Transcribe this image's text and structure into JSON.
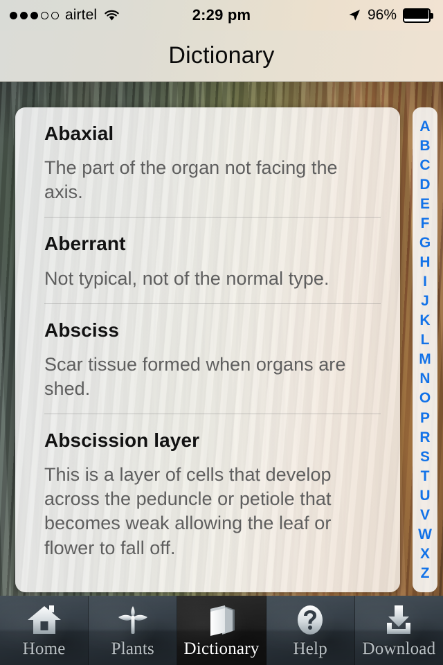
{
  "status_bar": {
    "signal_dots_filled": 3,
    "signal_dots_total": 5,
    "carrier": "airtel",
    "wifi_icon": "wifi-icon",
    "time": "2:29 pm",
    "location_icon": "location-arrow-icon",
    "battery_percent": "96%",
    "battery_level": 96
  },
  "navbar": {
    "title": "Dictionary"
  },
  "dictionary": {
    "entries": [
      {
        "term": "Abaxial",
        "definition": "The part of the organ not facing the axis."
      },
      {
        "term": "Aberrant",
        "definition": "Not typical, not of the normal type."
      },
      {
        "term": "Absciss",
        "definition": "Scar tissue formed when organs are shed."
      },
      {
        "term": "Abscission layer",
        "definition": "This is a layer of cells that develop across the peduncle or petiole that becomes weak allowing the leaf or flower to fall off."
      }
    ]
  },
  "index_strip": {
    "letters": [
      "A",
      "B",
      "C",
      "D",
      "E",
      "F",
      "G",
      "H",
      "I",
      "J",
      "K",
      "L",
      "M",
      "N",
      "O",
      "P",
      "R",
      "S",
      "T",
      "U",
      "V",
      "W",
      "X",
      "Z"
    ],
    "color": "#1272e8"
  },
  "tabbar": {
    "tabs": [
      {
        "label": "Home",
        "icon": "house-icon",
        "active": false
      },
      {
        "label": "Plants",
        "icon": "seedling-icon",
        "active": false
      },
      {
        "label": "Dictionary",
        "icon": "book-icon",
        "active": true
      },
      {
        "label": "Help",
        "icon": "question-mark-icon",
        "active": false
      },
      {
        "label": "Download",
        "icon": "download-icon",
        "active": false
      }
    ]
  },
  "theme": {
    "index_accent": "#1272e8",
    "term_color": "#121212",
    "definition_color": "#5e5e5e",
    "tab_active_label": "#ffffff",
    "tab_inactive_label": "#b9c0c4"
  }
}
